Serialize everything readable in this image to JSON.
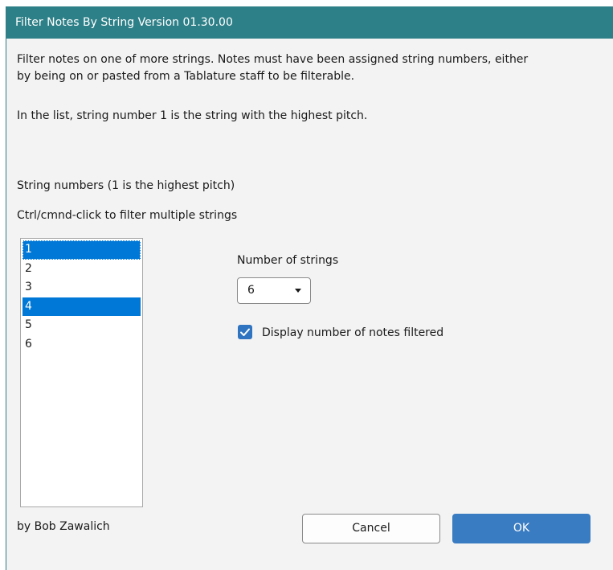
{
  "dialog": {
    "title": "Filter Notes By String Version 01.30.00",
    "description_line1": "Filter notes on one of more strings. Notes must have been assigned string numbers, either",
    "description_line2": "by being on or pasted from a Tablature staff to be filterable.",
    "description_line3": "In the list, string number 1 is the string with the highest pitch."
  },
  "strings_list": {
    "label": "String numbers (1 is the highest pitch)",
    "hint": "Ctrl/cmnd-click to filter multiple strings",
    "items": [
      {
        "label": "1",
        "selected": true,
        "focused": true
      },
      {
        "label": "2",
        "selected": false,
        "focused": false
      },
      {
        "label": "3",
        "selected": false,
        "focused": false
      },
      {
        "label": "4",
        "selected": true,
        "focused": false
      },
      {
        "label": "5",
        "selected": false,
        "focused": false
      },
      {
        "label": "6",
        "selected": false,
        "focused": false
      }
    ]
  },
  "number_of_strings": {
    "label": "Number of strings",
    "value": "6"
  },
  "display_count": {
    "label": "Display number of notes filtered",
    "checked": true
  },
  "footer": {
    "author": "by Bob Zawalich",
    "cancel_label": "Cancel",
    "ok_label": "OK"
  },
  "colors": {
    "titlebar": "#2e8088",
    "selection": "#0078d7",
    "primary_button": "#3a7cc2"
  }
}
